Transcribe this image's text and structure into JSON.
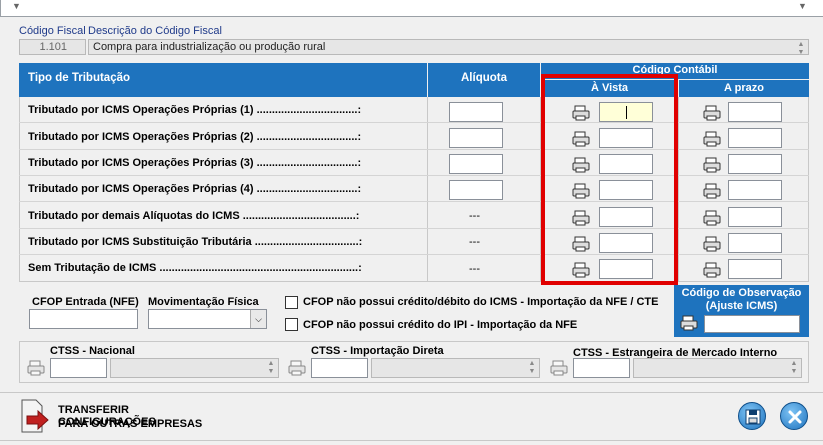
{
  "header": {
    "codigo_fiscal_label": "Código Fiscal",
    "descricao_label": "Descrição do Código Fiscal",
    "codigo_value": "1.101",
    "descricao_value": "Compra para industrialização ou produção rural"
  },
  "table": {
    "col_tipo": "Tipo de Tributação",
    "col_aliquota": "Alíquota",
    "col_contabil": "Código Contábil",
    "col_avista": "À Vista",
    "col_aprazo": "A prazo",
    "rows": [
      {
        "label": "Tributado por ICMS Operações Próprias (1) .................................:",
        "aliquota": ""
      },
      {
        "label": "Tributado por ICMS Operações Próprias (2) .................................:",
        "aliquota": ""
      },
      {
        "label": "Tributado por ICMS Operações Próprias (3) .................................:",
        "aliquota": ""
      },
      {
        "label": "Tributado por ICMS Operações Próprias (4) .................................:",
        "aliquota": ""
      },
      {
        "label": "Tributado por demais Alíquotas do ICMS .....................................:",
        "aliquota": "---"
      },
      {
        "label": "Tributado por ICMS Substituição Tributária ..................................:",
        "aliquota": "---"
      },
      {
        "label": "Sem Tributação de ICMS .................................................................:",
        "aliquota": "---"
      }
    ]
  },
  "cfop": {
    "entrada_label": "CFOP Entrada (NFE)",
    "movimentacao_label": "Movimentação Física",
    "check1_label": "CFOP não possui crédito/débito do ICMS -  Importação da NFE / CTE",
    "check2_label": "CFOP não possui crédito do IPI - Importação da NFE",
    "observacao_label": "Código de Observação (Ajuste ICMS)"
  },
  "ctss": {
    "nacional_label": "CTSS - Nacional",
    "importacao_label": "CTSS - Importação Direta",
    "estrangeira_label": "CTSS - Estrangeira de Mercado Interno"
  },
  "footer": {
    "transferir_label_1": "TRANSFERIR CONFIGURAÇÕES",
    "transferir_label_2": "PARA OUTRAS EMPRESAS"
  },
  "colors": {
    "header_blue": "#1e73be",
    "highlight_red": "#e00000",
    "active_field": "#ffffd8"
  }
}
